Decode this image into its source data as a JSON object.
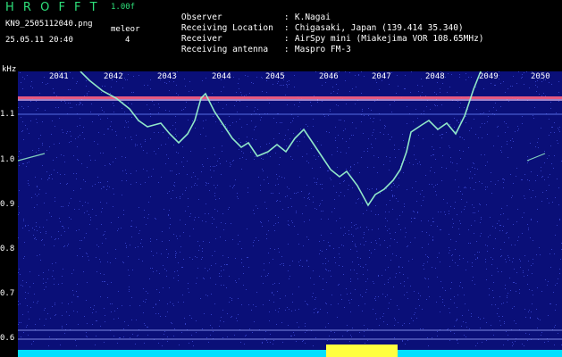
{
  "app": {
    "logo": "H R O F F T",
    "version": "1.00f",
    "file_name": "KN9_2505112040.png",
    "timestamp": "25.05.11 20:40",
    "meleor_label": "meleor",
    "meleor_count": "4"
  },
  "meta": [
    {
      "key": "Observer",
      "value": "K.Nagai"
    },
    {
      "key": "Receiving Location",
      "value": "Chigasaki, Japan (139.414 35.340)"
    },
    {
      "key": "Receiver",
      "value": "AirSpy mini (Miakejima VOR 108.65MHz)"
    },
    {
      "key": "Receiving antenna",
      "value": "Maspro FM-3"
    }
  ],
  "meta_separator": ":",
  "axes": {
    "y_unit": "kHz",
    "y_ticks": [
      "1.1",
      "1.0",
      "0.9",
      "0.8",
      "0.7",
      "0.6"
    ],
    "x_ticks": [
      "2041",
      "2042",
      "2043",
      "2044",
      "2045",
      "2046",
      "2047",
      "2048",
      "2049",
      "2050"
    ]
  },
  "colors": {
    "background": "#0a0f78",
    "noise": "#3a46d0",
    "trace": "#9fffd0",
    "carrier": "#ff6080",
    "baseline": "#00e0ff",
    "baseline_hot": "#ffff40"
  }
}
